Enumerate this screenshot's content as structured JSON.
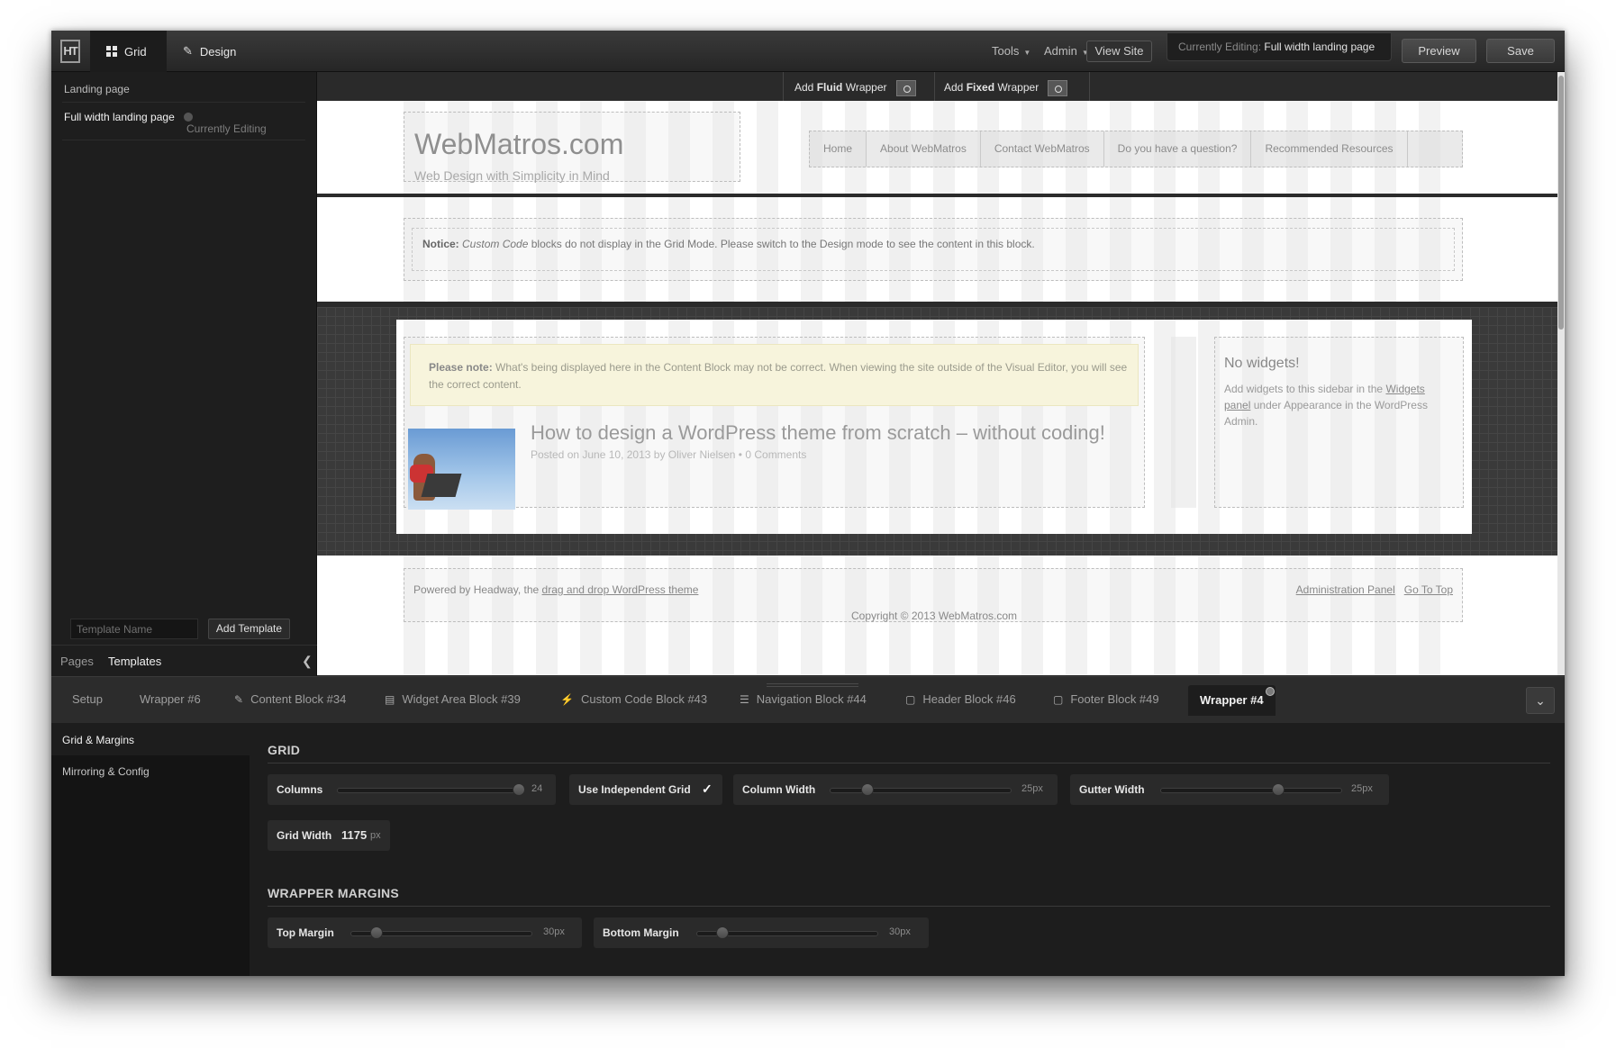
{
  "topbar": {
    "logo": "HT",
    "mode_grid": "Grid",
    "mode_design": "Design",
    "tools": "Tools",
    "admin": "Admin",
    "view_site": "View Site",
    "editing_label": "Currently Editing:",
    "editing_value": "Full width landing page",
    "preview": "Preview",
    "save": "Save"
  },
  "sidebar": {
    "items": [
      {
        "label": "Landing page"
      },
      {
        "label": "Full width landing page",
        "status": "Currently Editing"
      }
    ],
    "template_placeholder": "Template Name",
    "add_template": "Add Template",
    "tab_pages": "Pages",
    "tab_templates": "Templates"
  },
  "wrapper_toolbar": {
    "add_fluid_prefix": "Add",
    "add_fluid_bold": "Fluid",
    "add_fluid_suffix": "Wrapper",
    "add_fixed_prefix": "Add",
    "add_fixed_bold": "Fixed",
    "add_fixed_suffix": "Wrapper"
  },
  "site": {
    "title": "WebMatros.com",
    "tagline": "Web Design with Simplicity in Mind",
    "nav": [
      "Home",
      "About WebMatros",
      "Contact WebMatros",
      "Do you have a question?",
      "Recommended Resources"
    ],
    "notice_bold": "Notice:",
    "notice_italic": "Custom Code",
    "notice_rest": "blocks do not display in the Grid Mode. Please switch to the Design mode to see the content in this block.",
    "note_bold": "Please note:",
    "note_rest": "What's being displayed here in the Content Block may not be correct. When viewing the site outside of the Visual Editor, you will see the correct content.",
    "post_title": "How to design a WordPress theme from scratch – without coding!",
    "post_meta": "Posted on June 10, 2013 by Oliver Nielsen • 0 Comments",
    "widget_title": "No widgets!",
    "widget_text_1": "Add widgets to this sidebar in the",
    "widget_link": "Widgets panel",
    "widget_text_2": "under Appearance in the WordPress Admin.",
    "footer_text": "Powered by Headway, the",
    "footer_link": "drag and drop WordPress theme",
    "footer_admin": "Administration Panel",
    "footer_top": "Go To Top",
    "copyright": "Copyright © 2013 WebMatros.com"
  },
  "bottom_tabs": {
    "items": [
      {
        "label": "Setup",
        "icon": ""
      },
      {
        "label": "Wrapper #6",
        "icon": ""
      },
      {
        "label": "Content Block #34",
        "icon": "pencil-icon"
      },
      {
        "label": "Widget Area Block #39",
        "icon": "widget-icon"
      },
      {
        "label": "Custom Code Block #43",
        "icon": "code-icon"
      },
      {
        "label": "Navigation Block #44",
        "icon": "navigation-icon"
      },
      {
        "label": "Header Block #46",
        "icon": "header-icon"
      },
      {
        "label": "Footer Block #49",
        "icon": "footer-icon"
      }
    ],
    "active": "Wrapper #4"
  },
  "panel": {
    "side_grid_margins": "Grid & Margins",
    "side_mirroring": "Mirroring & Config",
    "grid_title": "GRID",
    "columns_label": "Columns",
    "columns_value": "24",
    "columns_fraction": 1.0,
    "independent_grid_label": "Use Independent Grid",
    "independent_grid_checked": "✓",
    "column_width_label": "Column Width",
    "column_width_value": "25px",
    "gutter_width_label": "Gutter Width",
    "gutter_width_value": "25px",
    "grid_width_label": "Grid Width",
    "grid_width_value": "1175",
    "grid_width_unit": "px",
    "margins_title": "WRAPPER MARGINS",
    "top_margin_label": "Top Margin",
    "top_margin_value": "30px",
    "bottom_margin_label": "Bottom Margin",
    "bottom_margin_value": "30px"
  }
}
